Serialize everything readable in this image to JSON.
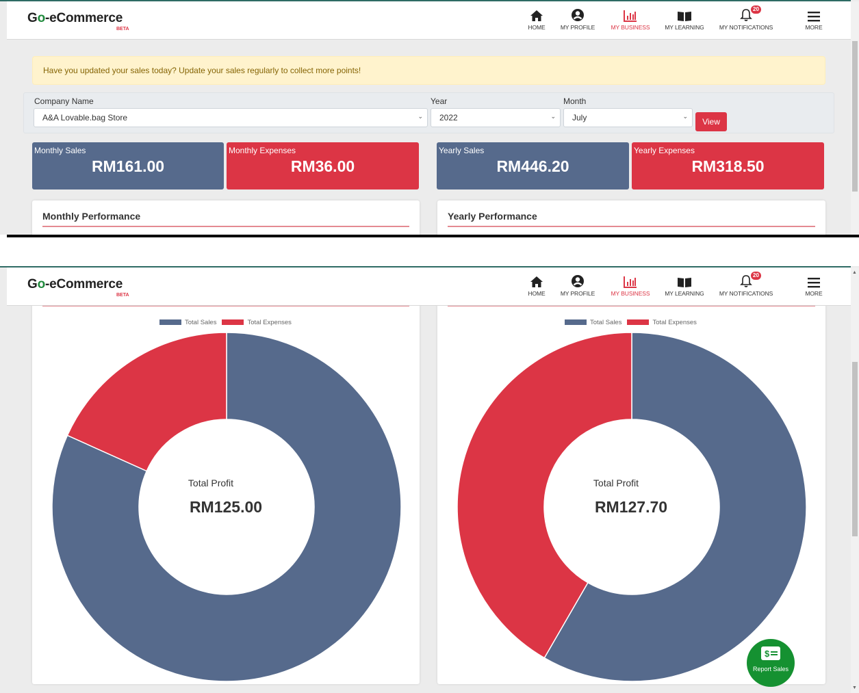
{
  "app": {
    "brand_prefix": "G",
    "brand_o": "o",
    "brand_suffix": "-eCommerce",
    "beta": "BETA"
  },
  "nav": {
    "home": "HOME",
    "profile": "MY PROFILE",
    "business": "MY BUSINESS",
    "learning": "MY LEARNING",
    "notifications": "MY NOTIFICATIONS",
    "notifications_count": "20",
    "more": "MORE"
  },
  "alert": "Have you updated your sales today? Update your sales regularly to collect more points!",
  "filters": {
    "company_label": "Company Name",
    "company_value": "A&A Lovable.bag Store",
    "year_label": "Year",
    "year_value": "2022",
    "month_label": "Month",
    "month_value": "July",
    "view_label": "View"
  },
  "stats": {
    "monthly_sales_label": "Monthly Sales",
    "monthly_sales_value": "RM161.00",
    "monthly_expenses_label": "Monthly Expenses",
    "monthly_expenses_value": "RM36.00",
    "yearly_sales_label": "Yearly Sales",
    "yearly_sales_value": "RM446.20",
    "yearly_expenses_label": "Yearly Expenses",
    "yearly_expenses_value": "RM318.50"
  },
  "cards": {
    "monthly_title": "Monthly Performance",
    "yearly_title": "Yearly Performance"
  },
  "colors": {
    "sales": "#566a8c",
    "expenses": "#dc3545",
    "fab": "#159131"
  },
  "fab": {
    "label": "Report Sales",
    "icon": "dollar-ticket-icon"
  },
  "chart_data": [
    {
      "type": "pie",
      "labels": [
        "Total Sales",
        "Total Expenses"
      ],
      "values": [
        161.0,
        36.0
      ],
      "center_label": "Total Profit",
      "center_value": "RM125.00",
      "legend": "top"
    },
    {
      "type": "pie",
      "labels": [
        "Total Sales",
        "Total Expenses"
      ],
      "values": [
        446.2,
        318.5
      ],
      "center_label": "Total Profit",
      "center_value": "RM127.70",
      "legend": "top"
    }
  ]
}
